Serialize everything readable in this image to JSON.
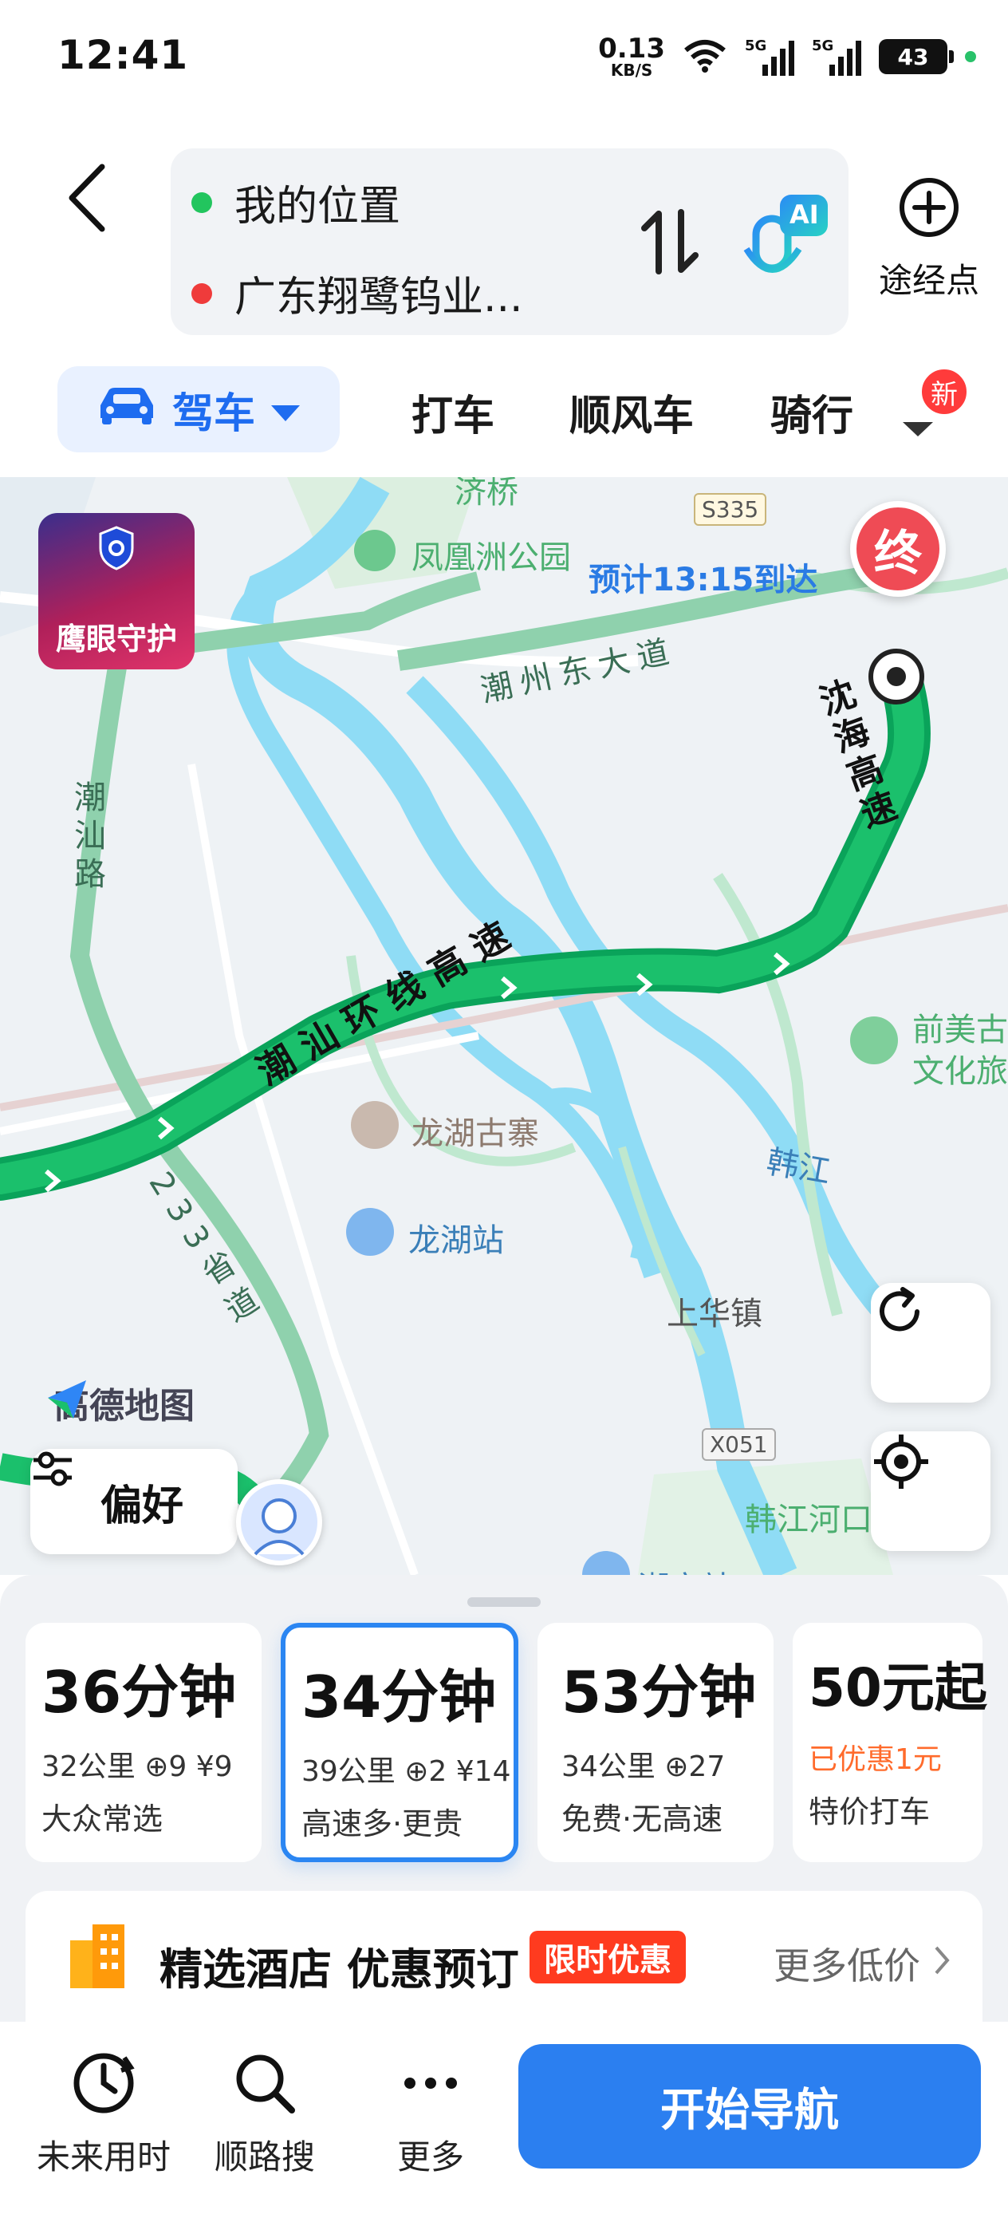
{
  "status_bar": {
    "time": "12:41",
    "net_speed": "0.13",
    "net_unit": "KB/S",
    "sig1_tag": "5G",
    "sig2_tag": "5G",
    "battery": "43"
  },
  "route": {
    "origin": "我的位置",
    "destination": "广东翔鹭钨业...",
    "waypoint_label": "途经点",
    "ai_badge": "AI"
  },
  "modes": {
    "drive": "驾车",
    "taxi": "打车",
    "carpool": "顺风车",
    "ride": "骑行",
    "new_badge": "新"
  },
  "map": {
    "eagle_label": "鹰眼守护",
    "end_label": "终",
    "eta": "预计13:15到达",
    "brand": "高德地图",
    "preference": "偏好",
    "labels": {
      "jiqiao": "济桥",
      "fenghuang": "凤凰洲公园",
      "chaozhou_east": "潮州东大道",
      "shenhai": "沈海高速",
      "chaoshan_road": "潮汕路",
      "chaoshan_ring": "潮汕环线高速",
      "qianmei": "前美古",
      "wenhua": "文化旅",
      "longhu_ancient": "龙湖古寨",
      "hanjiang": "韩江",
      "longhu_station": "龙湖站",
      "shanghua": "上华镇",
      "provincial233": "233省道",
      "hanjiang_estuary": "韩江河口",
      "chaoan_station": "潮安站",
      "s335": "S335",
      "x051": "X051"
    }
  },
  "routes": [
    {
      "time": "36分钟",
      "detail": "32公里 ⊕9 ¥9",
      "desc": "大众常选"
    },
    {
      "time": "34分钟",
      "detail": "39公里 ⊕2 ¥14",
      "desc": "高速多·更贵"
    },
    {
      "time": "53分钟",
      "detail": "34公里 ⊕27",
      "desc": "免费·无高速"
    },
    {
      "time": "50元起",
      "detail": "已优惠1元",
      "desc": "特价打车"
    }
  ],
  "hotel": {
    "title": "精选酒店 优惠预订",
    "tag": "限时优惠",
    "more": "更多低价"
  },
  "bottom_nav": {
    "future": "未来用时",
    "search_along": "顺路搜",
    "more": "更多",
    "start": "开始导航"
  }
}
